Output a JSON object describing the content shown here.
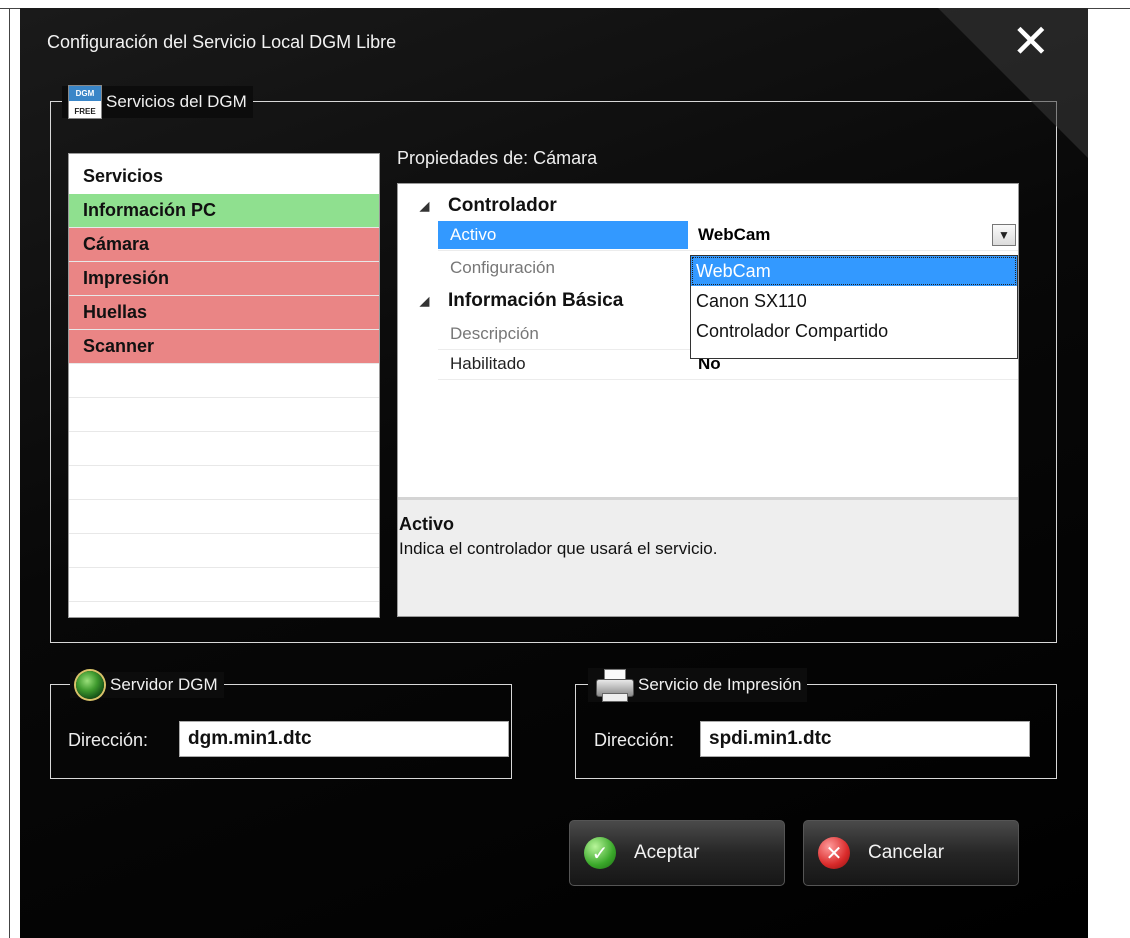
{
  "window": {
    "title": "Configuración del Servicio Local DGM Libre",
    "close_glyph": "✕"
  },
  "services_group": {
    "legend": "Servicios del DGM",
    "logo_top": "DGM",
    "logo_bottom": "FREE"
  },
  "services": {
    "header": "Servicios",
    "items": [
      {
        "label": "Información PC",
        "status": "green"
      },
      {
        "label": "Cámara",
        "status": "red"
      },
      {
        "label": "Impresión",
        "status": "red"
      },
      {
        "label": "Huellas",
        "status": "red"
      },
      {
        "label": "Scanner",
        "status": "red"
      }
    ]
  },
  "properties": {
    "label": "Propiedades de: Cámara",
    "category1": "Controlador",
    "category2": "Información Básica",
    "rows": {
      "activo_name": "Activo",
      "activo_value": "WebCam",
      "configuracion_name": "Configuración",
      "descripcion_name": "Descripción",
      "habilitado_name": "Habilitado",
      "habilitado_value": "No"
    },
    "dropdown_options": [
      "WebCam",
      "Canon SX110",
      "Controlador Compartido"
    ],
    "selected_option": "WebCam",
    "help_title": "Activo",
    "help_text": "Indica el controlador que usará el servicio."
  },
  "servidor": {
    "legend": "Servidor DGM",
    "address_label": "Dirección:",
    "address_value": "dgm.min1.dtc"
  },
  "impresion": {
    "legend": "Servicio de Impresión",
    "address_label": "Dirección:",
    "address_value": "spdi.min1.dtc"
  },
  "buttons": {
    "ok": "Aceptar",
    "cancel": "Cancelar"
  },
  "colors": {
    "status_green": "#8fe08f",
    "status_red": "#ea8585",
    "selection_blue": "#3399ff"
  }
}
